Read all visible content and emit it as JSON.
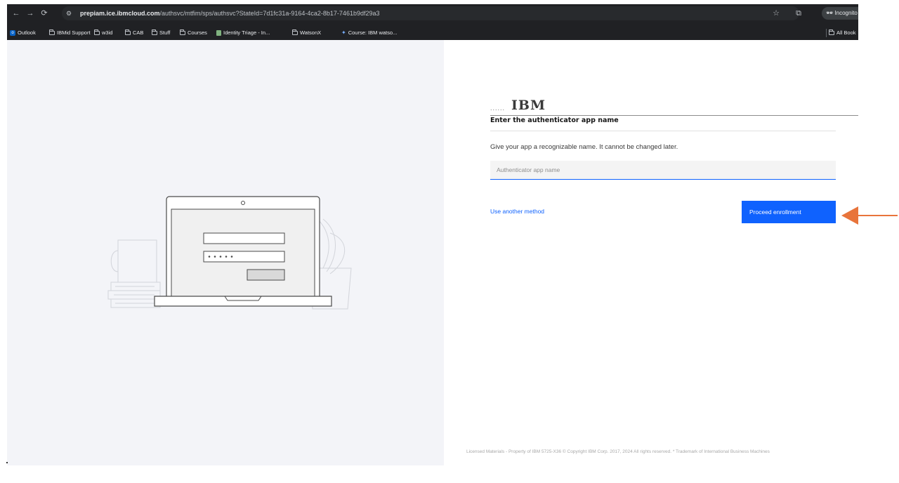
{
  "browser": {
    "url_host": "prepiam.ice.ibmcloud.com",
    "url_path": "/authsvc/mtfim/sps/authsvc?StateId=7d1fc31a-9164-4ca2-8b17-7461b9df29a3",
    "incognito_label": "Incognito",
    "bookmarks": [
      {
        "label": "Outlook",
        "icon": "outlook-icon"
      },
      {
        "label": "IBMid Support",
        "icon": "folder-icon"
      },
      {
        "label": "w3id",
        "icon": "folder-icon"
      },
      {
        "label": "CAB",
        "icon": "folder-icon"
      },
      {
        "label": "Stuff",
        "icon": "folder-icon"
      },
      {
        "label": "Courses",
        "icon": "folder-icon"
      },
      {
        "label": "Identity Triage - In...",
        "icon": "doc-icon"
      },
      {
        "label": "WatsonX",
        "icon": "folder-icon"
      },
      {
        "label": "Course: IBM watso...",
        "icon": "watson-icon"
      }
    ],
    "all_bookmarks_label": "All Book"
  },
  "form": {
    "logo_dots": "......",
    "logo": "IBM",
    "title": "Enter the authenticator app name",
    "description": "Give your app a recognizable name. It cannot be changed later.",
    "input_placeholder": "Authenticator app name",
    "input_value": "",
    "alt_method_link": "Use another method",
    "submit_label": "Proceed enrollment"
  },
  "footer": {
    "text": "Licensed Materials - Property of IBM 5725-X36 © Copyright IBM Corp. 2017, 2024 All rights reserved.  * Trademark of International Business Machines"
  },
  "colors": {
    "primary": "#0f62fe",
    "annotation_arrow": "#e8743b",
    "left_panel_bg": "#f3f4f8"
  }
}
